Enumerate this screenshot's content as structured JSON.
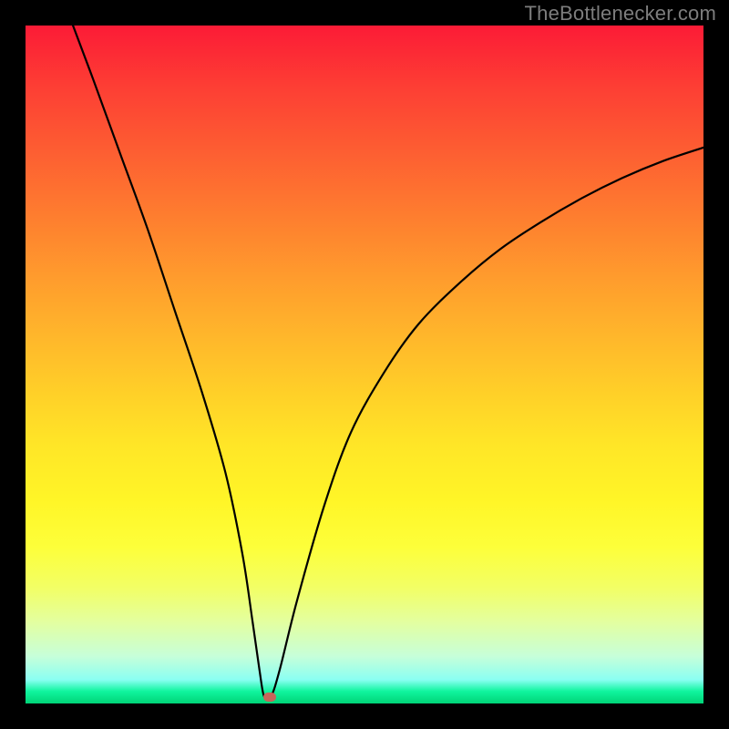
{
  "watermark": {
    "text": "TheBottlenecker.com"
  },
  "colors": {
    "frame": "#000000",
    "curve": "#000000",
    "marker": "#c6665a"
  },
  "chart_data": {
    "type": "line",
    "title": "",
    "xlabel": "",
    "ylabel": "",
    "xlim": [
      0,
      100
    ],
    "ylim": [
      0,
      100
    ],
    "series": [
      {
        "name": "bottleneck-curve",
        "x": [
          7,
          10,
          14,
          18,
          22,
          26,
          29.5,
          32,
          33.5,
          34.5,
          35.2,
          36.2,
          37.5,
          40,
          44,
          48,
          53,
          58,
          64,
          70,
          76,
          82,
          88,
          94,
          100
        ],
        "y": [
          100,
          92,
          81,
          70,
          58,
          46,
          34,
          22,
          12,
          5,
          1,
          1,
          5,
          15,
          29,
          40,
          49,
          56,
          62,
          67,
          71,
          74.5,
          77.5,
          80,
          82
        ]
      }
    ],
    "marker": {
      "x": 36,
      "y": 1
    },
    "annotations": []
  }
}
